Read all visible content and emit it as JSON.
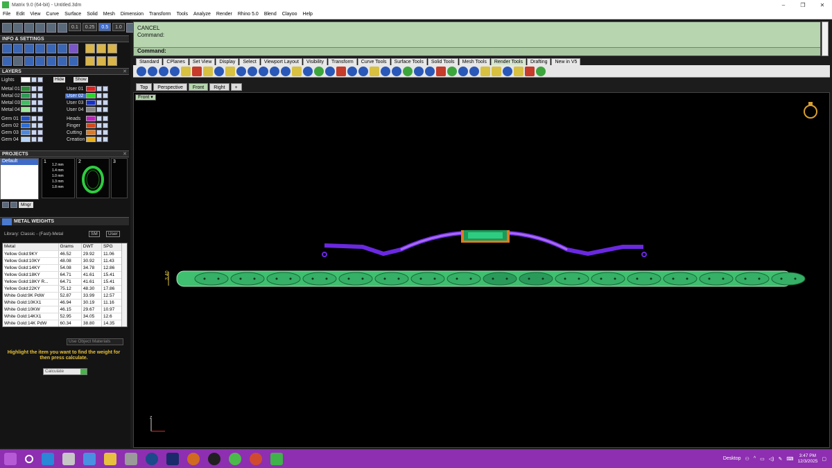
{
  "window": {
    "title": "Matrix 9.0 (64-bit) - Untitled.3dm",
    "minimize": "–",
    "restore": "❐",
    "close": "✕"
  },
  "menu": [
    "File",
    "Edit",
    "View",
    "Curve",
    "Surface",
    "Solid",
    "Mesh",
    "Dimension",
    "Transform",
    "Tools",
    "Analyze",
    "Render",
    "Rhino 5.0",
    "Blend",
    "Clayoo",
    "Help"
  ],
  "left_toolbar": {
    "zoom_values": [
      "0.1",
      "0.25",
      "0.5",
      "1.0"
    ]
  },
  "info_settings": {
    "title": "INFO & SETTINGS"
  },
  "layers": {
    "title": "LAYERS",
    "lights_label": "Lights",
    "hide_label": "Hide",
    "show_label": "Show",
    "left": [
      {
        "name": "Metal 01",
        "color": "#2e8b3a"
      },
      {
        "name": "Metal 02",
        "color": "#2e9b55"
      },
      {
        "name": "Metal 03",
        "color": "#3fbf5f"
      },
      {
        "name": "Metal 04",
        "color": "#9fe69f"
      },
      {
        "name": "Gem 01",
        "color": "#2151c7"
      },
      {
        "name": "Gem 02",
        "color": "#2f6fd4"
      },
      {
        "name": "Gem 03",
        "color": "#4d88e0"
      },
      {
        "name": "Gem 04",
        "color": "#b8d4f5"
      }
    ],
    "right": [
      {
        "name": "User 01",
        "color": "#e02020"
      },
      {
        "name": "User 02",
        "color": "#2dd52d",
        "selected": true
      },
      {
        "name": "User 03",
        "color": "#1530d0"
      },
      {
        "name": "User 04",
        "color": "#888888"
      },
      {
        "name": "Heads",
        "color": "#c020c0"
      },
      {
        "name": "Finger",
        "color": "#d04a20"
      },
      {
        "name": "Cutting",
        "color": "#e07a20"
      },
      {
        "name": "Creation",
        "color": "#e8b020"
      }
    ]
  },
  "projects": {
    "title": "PROJECTS",
    "items": [
      "Default"
    ],
    "thumbnails": [
      "1",
      "2",
      "3"
    ],
    "thumb1_lines": [
      "1.2 mm",
      "1.4 mm",
      "1.0 mm",
      "1.3 mm",
      "1.8 mm"
    ],
    "mngr_label": "Mngr"
  },
  "metal_weights": {
    "title": "METAL WEIGHTS",
    "library": "Library: Classic - (Fast)-Metal",
    "sm_label": "SM",
    "user_label": "User",
    "columns": [
      "Metal",
      "Grams",
      "DWT",
      "SPG"
    ],
    "rows": [
      [
        "Yellow Gold:9KY",
        "46.52",
        "29.92",
        "11.06"
      ],
      [
        "Yellow Gold:10KY",
        "48.08",
        "30.92",
        "11.43"
      ],
      [
        "Yellow Gold:14KY",
        "54.08",
        "34.78",
        "12.86"
      ],
      [
        "Yellow Gold:18KY",
        "64.71",
        "41.61",
        "15.41"
      ],
      [
        "Yellow Gold:18KY R...",
        "64.71",
        "41.61",
        "15.41"
      ],
      [
        "Yellow Gold:22KY",
        "75.12",
        "48.30",
        "17.86"
      ],
      [
        "White Gold:9K PdW",
        "52.87",
        "33.99",
        "12.57"
      ],
      [
        "White Gold:10KX1",
        "46.94",
        "30.19",
        "11.16"
      ],
      [
        "White Gold:10KW",
        "46.15",
        "29.67",
        "10.97"
      ],
      [
        "White Gold:14KX1",
        "52.95",
        "34.05",
        "12.6"
      ],
      [
        "White Gold:14K PdW",
        "60.34",
        "38.80",
        "14.35"
      ]
    ],
    "use_object_materials": "Use Object Materials",
    "hint": "Highlight the item you want to find the weight for then press calculate.",
    "calculate": "Calculate"
  },
  "command": {
    "line1": "CANCEL",
    "line2": "Command:",
    "prompt": "Command:"
  },
  "toolbar_tabs": [
    "Standard",
    "CPlanes",
    "Set View",
    "Display",
    "Select",
    "Viewport Layout",
    "Visibility",
    "Transform",
    "Curve Tools",
    "Surface Tools",
    "Solid Tools",
    "Mesh Tools",
    "Render Tools",
    "Drafting",
    "New in V5"
  ],
  "active_toolbar_tab": "Render Tools",
  "viewport_tabs": [
    "Top",
    "Perspective",
    "Front",
    "Right",
    "+"
  ],
  "active_viewport": "Front",
  "viewport": {
    "label": "Front",
    "dimension": "3.40",
    "axis_label": "z"
  },
  "taskbar": {
    "desktop_label": "Desktop",
    "time": "3:47 PM",
    "date": "12/3/2025"
  }
}
